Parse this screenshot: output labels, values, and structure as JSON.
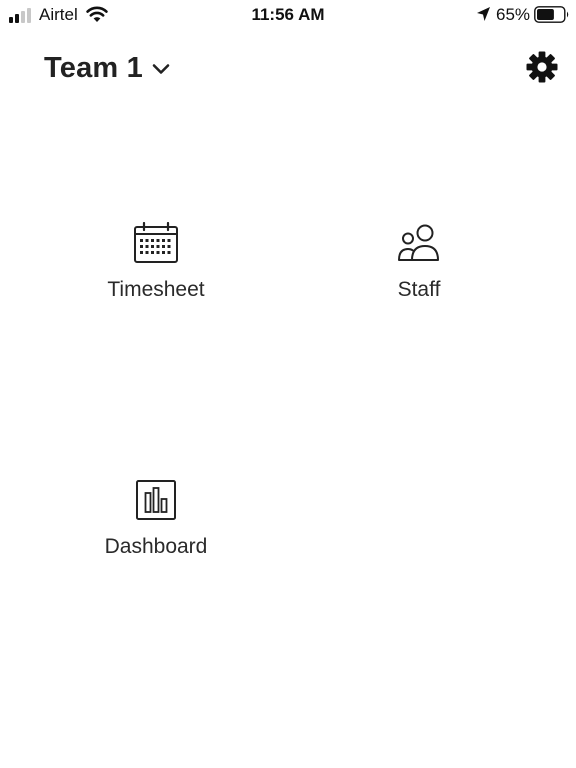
{
  "status_bar": {
    "carrier": "Airtel",
    "time": "11:56 AM",
    "battery_percent": "65%",
    "battery_level": 0.65
  },
  "header": {
    "team_name": "Team 1",
    "icons": {
      "switcher": "chevron-down-icon",
      "settings": "gear-icon"
    }
  },
  "menu": {
    "items": [
      {
        "label": "Timesheet",
        "icon": "calendar-icon"
      },
      {
        "label": "Staff",
        "icon": "people-icon"
      },
      {
        "label": "Dashboard",
        "icon": "bar-chart-icon"
      }
    ]
  },
  "colors": {
    "text": "#222222",
    "background": "#ffffff"
  }
}
